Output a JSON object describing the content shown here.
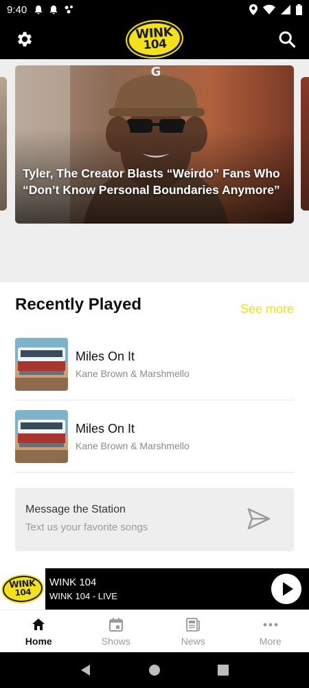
{
  "status_bar": {
    "time": "9:40"
  },
  "header": {
    "logo_line1": "WINK",
    "logo_line2": "104"
  },
  "hero": {
    "headline": "Tyler, The Creator Blasts “Weirdo” Fans Who “Don’t Know Personal Boundaries Anymore”"
  },
  "recently_played": {
    "title": "Recently Played",
    "see_more_label": "See more",
    "tracks": [
      {
        "name": "Miles On It",
        "artist": "Kane Brown & Marshmello"
      },
      {
        "name": "Miles On It",
        "artist": "Kane Brown & Marshmello"
      }
    ]
  },
  "message_card": {
    "title": "Message the Station",
    "subtitle": "Text us your favorite songs"
  },
  "player": {
    "station": "WINK 104",
    "status": "WINK 104 - LIVE"
  },
  "bottom_nav": {
    "items": [
      {
        "label": "Home",
        "icon": "home-icon",
        "active": true
      },
      {
        "label": "Shows",
        "icon": "calendar-icon",
        "active": false
      },
      {
        "label": "News",
        "icon": "newspaper-icon",
        "active": false
      },
      {
        "label": "More",
        "icon": "more-dots-icon",
        "active": false
      }
    ]
  },
  "colors": {
    "brand_yellow": "#f3e11b",
    "bar_black": "#000000",
    "card_gray": "#eeeeef"
  }
}
